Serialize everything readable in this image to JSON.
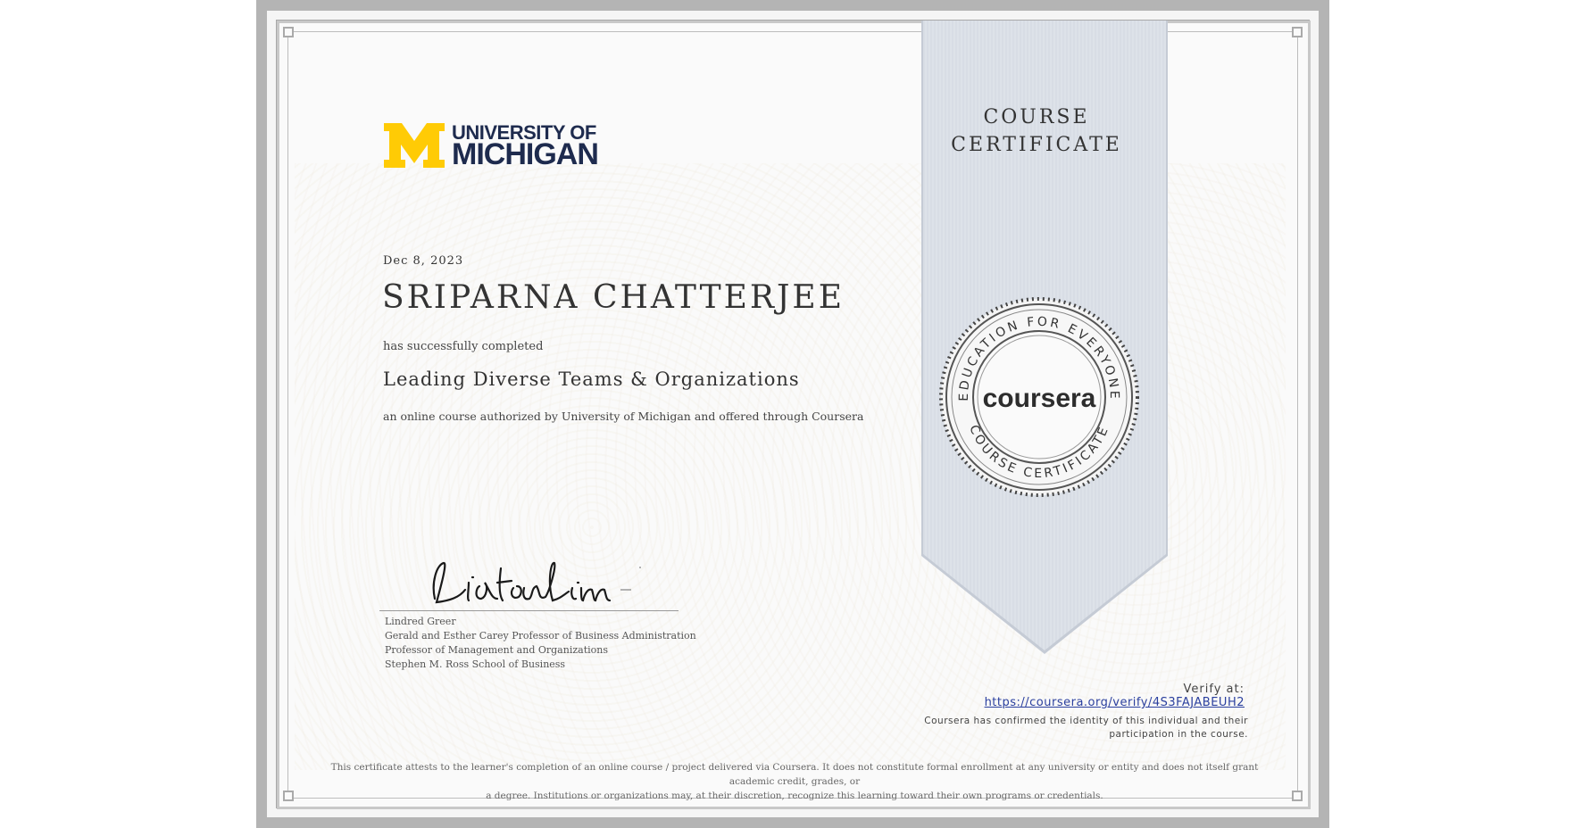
{
  "logo": {
    "line1": "UNIVERSITY OF",
    "line2": "MICHIGAN",
    "colors": {
      "maize": "#FFCB05",
      "blue": "#1E2B4E"
    }
  },
  "certificate": {
    "ribbon_title_line1": "COURSE",
    "ribbon_title_line2": "CERTIFICATE",
    "date": "Dec 8, 2023",
    "recipient_name": "SRIPARNA CHATTERJEE",
    "completed_text": "has successfully completed",
    "course_title": "Leading Diverse Teams & Organizations",
    "authorized_text": "an online course authorized by University of Michigan and offered through Coursera"
  },
  "signer": {
    "name": "Lindred Greer",
    "title1": "Gerald and Esther Carey Professor of Business Administration",
    "title2": "Professor of Management and Organizations",
    "title3": "Stephen M. Ross School of Business"
  },
  "seal": {
    "top_text": "EDUCATION FOR EVERYONE",
    "center_text": "coursera",
    "bottom_text": "COURSE CERTIFICATE"
  },
  "verify": {
    "label": "Verify at:",
    "url": "https://coursera.org/verify/4S3FAJABEUH2",
    "note": "Coursera has confirmed the identity of this individual and their participation in the course."
  },
  "disclaimer": {
    "line1": "This certificate attests to the learner's completion of an online course / project delivered via Coursera. It does not constitute formal enrollment at any university or entity and does not itself grant academic credit, grades, or",
    "line2": "a degree. Institutions or organizations may, at their discretion, recognize this learning toward their own programs or credentials."
  },
  "colors": {
    "frame": "#B4B4B4",
    "ribbon": "#DDE2E9",
    "link": "#2A3F9E",
    "text": "#333333"
  }
}
